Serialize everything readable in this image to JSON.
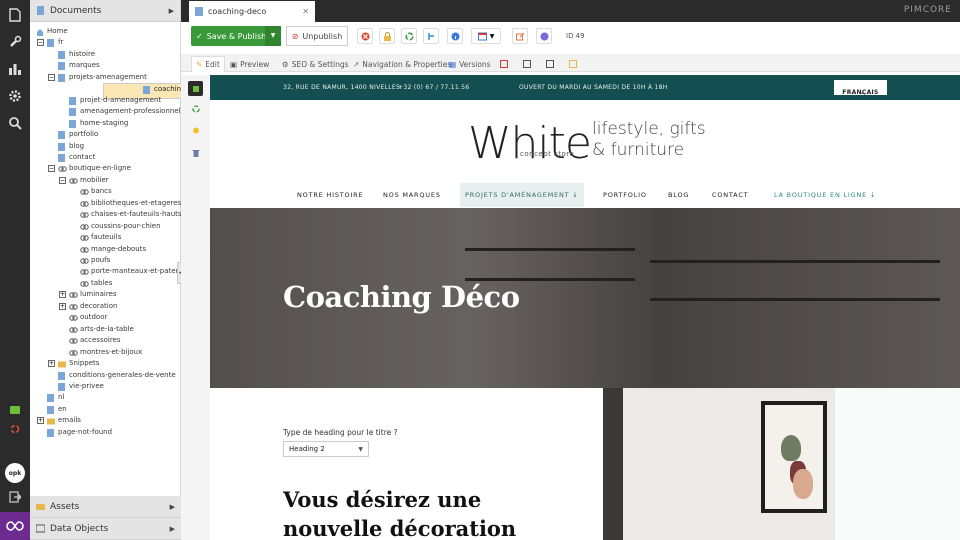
{
  "sidebar": {
    "documents_title": "Documents",
    "assets_title": "Assets",
    "data_objects_title": "Data Objects",
    "tree": [
      {
        "label": "Home",
        "level": 0,
        "icon": "home-icon",
        "toggle": ""
      },
      {
        "label": "fr",
        "level": 1,
        "icon": "page-icon",
        "toggle": "−"
      },
      {
        "label": "histoire",
        "level": 2,
        "icon": "page-icon",
        "toggle": ""
      },
      {
        "label": "marques",
        "level": 2,
        "icon": "page-icon",
        "toggle": ""
      },
      {
        "label": "projets-amenagement",
        "level": 2,
        "icon": "page-icon",
        "toggle": "−"
      },
      {
        "label": "coaching-deco",
        "level": 3,
        "icon": "page-icon",
        "toggle": "",
        "selected": true
      },
      {
        "label": "projet-d-amenagement",
        "level": 3,
        "icon": "page-icon",
        "toggle": ""
      },
      {
        "label": "amenagement-professionnel",
        "level": 3,
        "icon": "page-icon",
        "toggle": ""
      },
      {
        "label": "home-staging",
        "level": 3,
        "icon": "page-icon",
        "toggle": ""
      },
      {
        "label": "portfolio",
        "level": 2,
        "icon": "page-icon",
        "toggle": ""
      },
      {
        "label": "blog",
        "level": 2,
        "icon": "page-icon",
        "toggle": ""
      },
      {
        "label": "contact",
        "level": 2,
        "icon": "page-icon",
        "toggle": ""
      },
      {
        "label": "boutique-en-ligne",
        "level": 2,
        "icon": "link-icon",
        "toggle": "−"
      },
      {
        "label": "mobilier",
        "level": 3,
        "icon": "link-icon",
        "toggle": "−"
      },
      {
        "label": "bancs",
        "level": 4,
        "icon": "link-icon",
        "toggle": ""
      },
      {
        "label": "bibliotheques-et-etageres",
        "level": 4,
        "icon": "link-icon",
        "toggle": ""
      },
      {
        "label": "chaises-et-fauteuils-hauts",
        "level": 4,
        "icon": "link-icon",
        "toggle": ""
      },
      {
        "label": "coussins-pour-chien",
        "level": 4,
        "icon": "link-icon",
        "toggle": ""
      },
      {
        "label": "fauteuils",
        "level": 4,
        "icon": "link-icon",
        "toggle": ""
      },
      {
        "label": "mange-debouts",
        "level": 4,
        "icon": "link-icon",
        "toggle": ""
      },
      {
        "label": "poufs",
        "level": 4,
        "icon": "link-icon",
        "toggle": ""
      },
      {
        "label": "porte-manteaux-et-pateres",
        "level": 4,
        "icon": "link-icon",
        "toggle": ""
      },
      {
        "label": "tables",
        "level": 4,
        "icon": "link-icon",
        "toggle": ""
      },
      {
        "label": "luminaires",
        "level": 3,
        "icon": "link-icon",
        "toggle": "+"
      },
      {
        "label": "decoration",
        "level": 3,
        "icon": "link-icon",
        "toggle": "+"
      },
      {
        "label": "outdoor",
        "level": 3,
        "icon": "link-icon",
        "toggle": ""
      },
      {
        "label": "arts-de-la-table",
        "level": 3,
        "icon": "link-icon",
        "toggle": ""
      },
      {
        "label": "accessoires",
        "level": 3,
        "icon": "link-icon",
        "toggle": ""
      },
      {
        "label": "montres-et-bijoux",
        "level": 3,
        "icon": "link-icon",
        "toggle": ""
      },
      {
        "label": "Snippets",
        "level": 2,
        "icon": "folder-icon",
        "toggle": "+"
      },
      {
        "label": "conditions-generales-de-vente",
        "level": 2,
        "icon": "page-icon",
        "toggle": ""
      },
      {
        "label": "vie-privee",
        "level": 2,
        "icon": "page-icon",
        "toggle": ""
      },
      {
        "label": "nl",
        "level": 1,
        "icon": "page-icon",
        "toggle": ""
      },
      {
        "label": "en",
        "level": 1,
        "icon": "page-icon",
        "toggle": ""
      },
      {
        "label": "emails",
        "level": 1,
        "icon": "folder-icon",
        "toggle": "+"
      },
      {
        "label": "page-not-found",
        "level": 1,
        "icon": "page-icon",
        "toggle": ""
      }
    ]
  },
  "topbar": {
    "doc_tab": "coaching-deco",
    "brand": "PIMCORE"
  },
  "toolbar": {
    "save_label": "Save & Publish",
    "unpublish_label": "Unpublish",
    "id_label": "ID 49"
  },
  "tabs": [
    {
      "label": "Edit",
      "icon": "pencil-icon",
      "active": true
    },
    {
      "label": "Preview",
      "icon": "preview-icon"
    },
    {
      "label": "SEO & Settings",
      "icon": "gear-icon"
    },
    {
      "label": "Navigation & Properties",
      "icon": "navigation-icon"
    },
    {
      "label": "Versions",
      "icon": "versions-icon"
    }
  ],
  "site": {
    "address": "32, RUE DE NAMUR, 1400 NIVELLES",
    "phone": "+32 (0) 67 / 77.11.56",
    "hours": "OUVERT DU MARDI AU SAMEDI DE 10H À 18H",
    "language": "FRANÇAIS",
    "brand": "White",
    "brand_sub": "concept store",
    "tagline_1": "lifestyle, gifts",
    "tagline_2": "& furniture",
    "nav": [
      {
        "label": "NOTRE HISTOIRE"
      },
      {
        "label": "NOS MARQUES"
      },
      {
        "label": "PROJETS D'AMÉNAGEMENT ↓",
        "highlight": true
      },
      {
        "label": "PORTFOLIO"
      },
      {
        "label": "BLOG"
      },
      {
        "label": "CONTACT"
      },
      {
        "label": "LA BOUTIQUE EN LIGNE ↓",
        "teal": true
      }
    ],
    "hero_title": "Coaching Déco",
    "heading_type_label": "Type de heading pour le titre ?",
    "heading_type_value": "Heading 2",
    "section_heading": "Vous désirez une nouvelle décoration"
  },
  "colors": {
    "accent_green": "#3a9a3a",
    "teal": "#134e51",
    "selected_row": "#fbe7b3"
  }
}
